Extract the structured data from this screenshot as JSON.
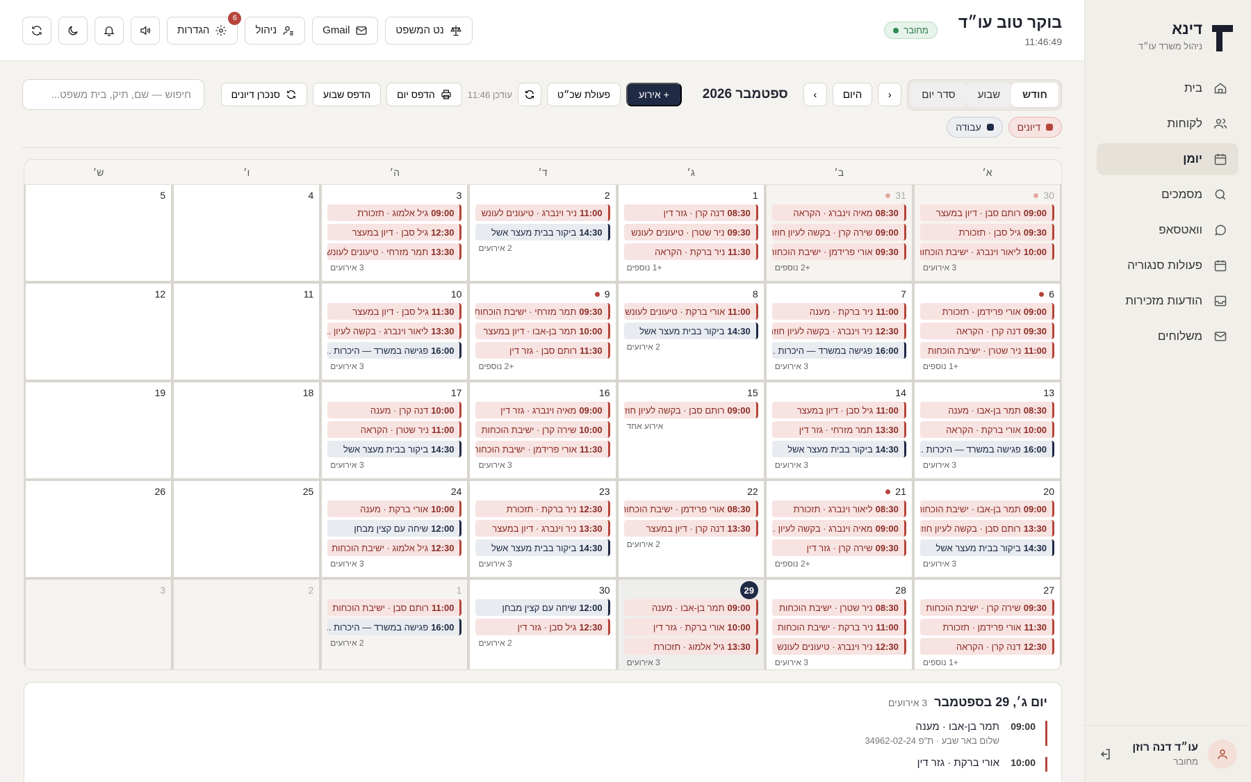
{
  "sidebar": {
    "brand_name": "דינא",
    "brand_sub": "ניהול משרד עו״ד",
    "items": [
      {
        "label": "בית",
        "icon": "home-icon"
      },
      {
        "label": "לקוחות",
        "icon": "users-icon"
      },
      {
        "label": "יומן",
        "icon": "calendar-icon",
        "active": true
      },
      {
        "label": "מסמכים",
        "icon": "search-icon"
      },
      {
        "label": "וואטסאפ",
        "icon": "chat-icon"
      },
      {
        "label": "פעולות סנגוריה",
        "icon": "calendar-icon"
      },
      {
        "label": "הודעות מזכירות",
        "icon": "inbox-icon"
      },
      {
        "label": "משלוחים",
        "icon": "mail-icon"
      }
    ],
    "user": {
      "name": "עו״ד דנה רוזן",
      "status": "מחובר"
    }
  },
  "topbar": {
    "greeting": "בוקר טוב עו״ד",
    "clock": "11:46:49",
    "status": "מחובר",
    "buttons": {
      "netlaw": "נט המשפט",
      "gmail": "Gmail",
      "manage": "ניהול",
      "settings": "הגדרות",
      "settings_badge": "6"
    }
  },
  "toolbar": {
    "views": [
      "חודש",
      "שבוע",
      "סדר יום"
    ],
    "active_view": "חודש",
    "today": "היום",
    "month_title": "ספטמבר 2026",
    "add_event": "+ אירוע",
    "bulk_action": "פעולת שכ״ט",
    "updated": "עודכן 11:46",
    "print_day": "הדפס יום",
    "print_week": "הדפס שבוע",
    "sync": "סנכרן דיונים",
    "search_placeholder": "חיפוש — שם, תיק, בית משפט..."
  },
  "filters": [
    {
      "label": "דיונים",
      "color": "#b5443a"
    },
    {
      "label": "עבודה",
      "color": "#1f2a44"
    }
  ],
  "calendar": {
    "weekdays": [
      "א׳",
      "ב׳",
      "ג׳",
      "ד׳",
      "ה׳",
      "ו׳",
      "ש׳"
    ],
    "weeks": [
      [
        {
          "day": "30",
          "outside": true,
          "dot": true,
          "events": [
            {
              "t": "09:00",
              "x": "רותם סבן · דיון במעצר",
              "k": "hearing"
            },
            {
              "t": "09:30",
              "x": "גיל סבן · תזכורת",
              "k": "hearing"
            },
            {
              "t": "10:00",
              "x": "ליאור וינברג · ישיבת הוכחות",
              "k": "hearing"
            }
          ],
          "more": "3 אירועים"
        },
        {
          "day": "31",
          "outside": true,
          "dot": true,
          "events": [
            {
              "t": "08:30",
              "x": "מאיה וינברג · הקראה",
              "k": "hearing"
            },
            {
              "t": "09:00",
              "x": "שירה קרן · בקשה לעיון חוזר",
              "k": "hearing"
            },
            {
              "t": "09:30",
              "x": "אורי פרידמן · ישיבת הוכחות",
              "k": "hearing"
            }
          ],
          "more": "+2 נוספים"
        },
        {
          "day": "1",
          "events": [
            {
              "t": "08:30",
              "x": "דנה קרן · גזר דין",
              "k": "hearing"
            },
            {
              "t": "09:30",
              "x": "ניר שטרן · טיעונים לעונש",
              "k": "hearing"
            },
            {
              "t": "11:30",
              "x": "ניר ברקת · הקראה",
              "k": "hearing"
            }
          ],
          "more": "+1 נוספים"
        },
        {
          "day": "2",
          "events": [
            {
              "t": "11:00",
              "x": "ניר וינברג · טיעונים לעונש",
              "k": "hearing"
            },
            {
              "t": "14:30",
              "x": "ביקור בבית מעצר אשל",
              "k": "work"
            }
          ],
          "more": "2 אירועים"
        },
        {
          "day": "3",
          "events": [
            {
              "t": "09:00",
              "x": "גיל אלמוג · תזכורת",
              "k": "hearing"
            },
            {
              "t": "12:30",
              "x": "גיל סבן · דיון במעצר",
              "k": "hearing"
            },
            {
              "t": "13:30",
              "x": "תמר מזרחי · טיעונים לעונש",
              "k": "hearing"
            }
          ],
          "more": "3 אירועים"
        },
        {
          "day": "4",
          "events": []
        },
        {
          "day": "5",
          "events": []
        }
      ],
      [
        {
          "day": "6",
          "dot": true,
          "events": [
            {
              "t": "09:00",
              "x": "אורי פרידמן · תזכורת",
              "k": "hearing"
            },
            {
              "t": "09:30",
              "x": "דנה קרן · הקראה",
              "k": "hearing"
            },
            {
              "t": "11:00",
              "x": "ניר שטרן · ישיבת הוכחות",
              "k": "hearing"
            }
          ],
          "more": "+1 נוספים"
        },
        {
          "day": "7",
          "events": [
            {
              "t": "11:00",
              "x": "ניר ברקת · מענה",
              "k": "hearing"
            },
            {
              "t": "12:30",
              "x": "ניר וינברג · בקשה לעיון חוזר",
              "k": "hearing"
            },
            {
              "t": "16:00",
              "x": "פגישה במשרד — היכרות ...",
              "k": "work"
            }
          ],
          "more": "3 אירועים"
        },
        {
          "day": "8",
          "events": [
            {
              "t": "11:00",
              "x": "אורי ברקת · טיעונים לעונש",
              "k": "hearing"
            },
            {
              "t": "14:30",
              "x": "ביקור בבית מעצר אשל",
              "k": "work"
            }
          ],
          "more": "2 אירועים"
        },
        {
          "day": "9",
          "dot": true,
          "events": [
            {
              "t": "09:30",
              "x": "תמר מזרחי · ישיבת הוכחות",
              "k": "hearing"
            },
            {
              "t": "10:00",
              "x": "תמר בן-אבו · דיון במעצר",
              "k": "hearing"
            },
            {
              "t": "11:30",
              "x": "רותם סבן · גזר דין",
              "k": "hearing"
            }
          ],
          "more": "+2 נוספים"
        },
        {
          "day": "10",
          "events": [
            {
              "t": "11:30",
              "x": "גיל סבן · דיון במעצר",
              "k": "hearing"
            },
            {
              "t": "13:30",
              "x": "ליאור וינברג · בקשה לעיון ...",
              "k": "hearing"
            },
            {
              "t": "16:00",
              "x": "פגישה במשרד — היכרות ...",
              "k": "work"
            }
          ],
          "more": "3 אירועים"
        },
        {
          "day": "11",
          "events": []
        },
        {
          "day": "12",
          "events": []
        }
      ],
      [
        {
          "day": "13",
          "events": [
            {
              "t": "08:30",
              "x": "תמר בן-אבו · מענה",
              "k": "hearing"
            },
            {
              "t": "10:00",
              "x": "אורי ברקת · הקראה",
              "k": "hearing"
            },
            {
              "t": "16:00",
              "x": "פגישה במשרד — היכרות ...",
              "k": "work"
            }
          ],
          "more": "3 אירועים"
        },
        {
          "day": "14",
          "events": [
            {
              "t": "11:00",
              "x": "גיל סבן · דיון במעצר",
              "k": "hearing"
            },
            {
              "t": "13:30",
              "x": "תמר מזרחי · גזר דין",
              "k": "hearing"
            },
            {
              "t": "14:30",
              "x": "ביקור בבית מעצר אשל",
              "k": "work"
            }
          ],
          "more": "3 אירועים"
        },
        {
          "day": "15",
          "events": [
            {
              "t": "09:00",
              "x": "רותם סבן · בקשה לעיון חוזר",
              "k": "hearing"
            }
          ],
          "more": "אירוע אחד"
        },
        {
          "day": "16",
          "events": [
            {
              "t": "09:00",
              "x": "מאיה וינברג · גזר דין",
              "k": "hearing"
            },
            {
              "t": "10:00",
              "x": "שירה קרן · ישיבת הוכחות",
              "k": "hearing"
            },
            {
              "t": "11:30",
              "x": "אורי פרידמן · ישיבת הוכחות",
              "k": "hearing"
            }
          ],
          "more": "3 אירועים"
        },
        {
          "day": "17",
          "events": [
            {
              "t": "10:00",
              "x": "דנה קרן · מענה",
              "k": "hearing"
            },
            {
              "t": "11:00",
              "x": "ניר שטרן · הקראה",
              "k": "hearing"
            },
            {
              "t": "14:30",
              "x": "ביקור בבית מעצר אשל",
              "k": "work"
            }
          ],
          "more": "3 אירועים"
        },
        {
          "day": "18",
          "events": []
        },
        {
          "day": "19",
          "events": []
        }
      ],
      [
        {
          "day": "20",
          "events": [
            {
              "t": "09:00",
              "x": "תמר בן-אבו · ישיבת הוכחות",
              "k": "hearing"
            },
            {
              "t": "13:30",
              "x": "רותם סבן · בקשה לעיון חוזר",
              "k": "hearing"
            },
            {
              "t": "14:30",
              "x": "ביקור בבית מעצר אשל",
              "k": "work"
            }
          ],
          "more": "3 אירועים"
        },
        {
          "day": "21",
          "dot": true,
          "events": [
            {
              "t": "08:30",
              "x": "ליאור וינברג · תזכורת",
              "k": "hearing"
            },
            {
              "t": "09:00",
              "x": "מאיה וינברג · בקשה לעיון ...",
              "k": "hearing"
            },
            {
              "t": "09:30",
              "x": "שירה קרן · גזר דין",
              "k": "hearing"
            }
          ],
          "more": "+2 נוספים"
        },
        {
          "day": "22",
          "events": [
            {
              "t": "08:30",
              "x": "אורי פרידמן · ישיבת הוכחות",
              "k": "hearing"
            },
            {
              "t": "13:30",
              "x": "דנה קרן · דיון במעצר",
              "k": "hearing"
            }
          ],
          "more": "2 אירועים"
        },
        {
          "day": "23",
          "events": [
            {
              "t": "12:30",
              "x": "ניר ברקת · תזכורת",
              "k": "hearing"
            },
            {
              "t": "13:30",
              "x": "ניר וינברג · דיון במעצר",
              "k": "hearing"
            },
            {
              "t": "14:30",
              "x": "ביקור בבית מעצר אשל",
              "k": "work"
            }
          ],
          "more": "3 אירועים"
        },
        {
          "day": "24",
          "events": [
            {
              "t": "10:00",
              "x": "אורי ברקת · מענה",
              "k": "hearing"
            },
            {
              "t": "12:00",
              "x": "שיחה עם קצין מבחן",
              "k": "work"
            },
            {
              "t": "12:30",
              "x": "גיל אלמוג · ישיבת הוכחות",
              "k": "hearing"
            }
          ],
          "more": "3 אירועים"
        },
        {
          "day": "25",
          "events": []
        },
        {
          "day": "26",
          "events": []
        }
      ],
      [
        {
          "day": "27",
          "events": [
            {
              "t": "09:30",
              "x": "שירה קרן · ישיבת הוכחות",
              "k": "hearing"
            },
            {
              "t": "11:30",
              "x": "אורי פרידמן · תזכורת",
              "k": "hearing"
            },
            {
              "t": "12:30",
              "x": "דנה קרן · הקראה",
              "k": "hearing"
            }
          ],
          "more": "+1 נוספים"
        },
        {
          "day": "28",
          "events": [
            {
              "t": "08:30",
              "x": "ניר שטרן · ישיבת הוכחות",
              "k": "hearing"
            },
            {
              "t": "11:00",
              "x": "ניר ברקת · ישיבת הוכחות",
              "k": "hearing"
            },
            {
              "t": "12:30",
              "x": "ניר וינברג · טיעונים לעונש",
              "k": "hearing"
            }
          ],
          "more": "3 אירועים"
        },
        {
          "day": "29",
          "today": true,
          "events": [
            {
              "t": "09:00",
              "x": "תמר בן-אבו · מענה",
              "k": "hearing"
            },
            {
              "t": "10:00",
              "x": "אורי ברקת · גזר דין",
              "k": "hearing"
            },
            {
              "t": "13:30",
              "x": "גיל אלמוג · תזכורת",
              "k": "hearing"
            }
          ],
          "more": "3 אירועים"
        },
        {
          "day": "30",
          "events": [
            {
              "t": "12:00",
              "x": "שיחה עם קצין מבחן",
              "k": "work"
            },
            {
              "t": "12:30",
              "x": "גיל סבן · גזר דין",
              "k": "hearing"
            }
          ],
          "more": "2 אירועים"
        },
        {
          "day": "1",
          "outside": true,
          "events": [
            {
              "t": "11:00",
              "x": "רותם סבן · ישיבת הוכחות",
              "k": "hearing"
            },
            {
              "t": "16:00",
              "x": "פגישה במשרד — היכרות ...",
              "k": "work"
            }
          ],
          "more": "2 אירועים"
        },
        {
          "day": "2",
          "outside": true,
          "events": []
        },
        {
          "day": "3",
          "outside": true,
          "events": []
        }
      ]
    ]
  },
  "day_panel": {
    "title": "יום ג׳, 29 בספטמבר",
    "count": "3 אירועים",
    "events": [
      {
        "time": "09:00",
        "title": "תמר בן-אבו · מענה",
        "sub": "שלום באר שבע · ת\"פ 34962-02-24"
      },
      {
        "time": "10:00",
        "title": "אורי ברקת · גזר דין",
        "sub": ""
      }
    ]
  }
}
